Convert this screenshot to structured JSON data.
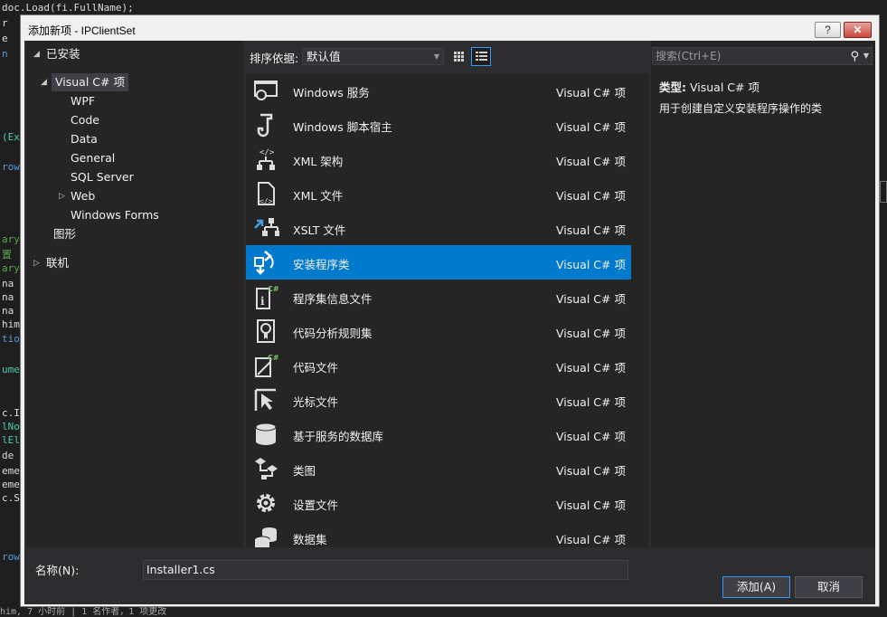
{
  "background_code": {
    "lines": [
      {
        "text": "doc.Load(fi.FullName);",
        "color": "#dcdcdc"
      },
      {
        "text": "r",
        "color": "#dcdcdc"
      },
      {
        "text": "e",
        "color": "#dcdcdc"
      },
      {
        "text": "n",
        "color": "#569cd6"
      },
      {
        "text": "(Ex",
        "color": "#4ec9b0"
      },
      {
        "text": "row",
        "color": "#569cd6"
      },
      {
        "text": "ary",
        "color": "#57a64a"
      },
      {
        "text": "置",
        "color": "#57a64a"
      },
      {
        "text": "ary",
        "color": "#57a64a"
      },
      {
        "text": "na",
        "color": "#dcdcdc"
      },
      {
        "text": "na",
        "color": "#dcdcdc"
      },
      {
        "text": "na",
        "color": "#dcdcdc"
      },
      {
        "text": "him",
        "color": "#dcdcdc"
      },
      {
        "text": "tio",
        "color": "#569cd6"
      },
      {
        "text": "ume",
        "color": "#4ec9b0"
      },
      {
        "text": "c.I",
        "color": "#dcdcdc"
      },
      {
        "text": "lNo",
        "color": "#4ec9b0"
      },
      {
        "text": "lEl",
        "color": "#4ec9b0"
      },
      {
        "text": "de",
        "color": "#dcdcdc"
      },
      {
        "text": "eme",
        "color": "#dcdcdc"
      },
      {
        "text": "eme",
        "color": "#dcdcdc"
      },
      {
        "text": "c.S",
        "color": "#dcdcdc"
      },
      {
        "text": "row",
        "color": "#569cd6"
      }
    ],
    "status_text": "him, 7 小时前 | 1 名作者，1 项更改"
  },
  "dialog": {
    "title": "添加新项 - IPClientSet",
    "help_label": "?",
    "close_label": "✕"
  },
  "tree": {
    "installed": "已安装",
    "visual_csharp": "Visual C# 项",
    "children": [
      "WPF",
      "Code",
      "Data",
      "General",
      "SQL Server",
      "Web",
      "Windows Forms"
    ],
    "graphics": "图形",
    "online": "联机"
  },
  "toolbar": {
    "sort_label": "排序依据:",
    "sort_value": "默认值"
  },
  "search": {
    "placeholder": "搜索(Ctrl+E)"
  },
  "items": [
    {
      "name": "Windows 服务",
      "type": "Visual C# 项",
      "icon": "windows-service-icon"
    },
    {
      "name": "Windows 脚本宿主",
      "type": "Visual C# 项",
      "icon": "script-host-icon"
    },
    {
      "name": "XML 架构",
      "type": "Visual C# 项",
      "icon": "xml-schema-icon"
    },
    {
      "name": "XML 文件",
      "type": "Visual C# 项",
      "icon": "xml-file-icon"
    },
    {
      "name": "XSLT 文件",
      "type": "Visual C# 项",
      "icon": "xslt-file-icon"
    },
    {
      "name": "安装程序类",
      "type": "Visual C# 项",
      "icon": "installer-class-icon",
      "selected": true
    },
    {
      "name": "程序集信息文件",
      "type": "Visual C# 项",
      "icon": "assembly-info-icon"
    },
    {
      "name": "代码分析规则集",
      "type": "Visual C# 项",
      "icon": "ruleset-icon"
    },
    {
      "name": "代码文件",
      "type": "Visual C# 项",
      "icon": "code-file-icon"
    },
    {
      "name": "光标文件",
      "type": "Visual C# 项",
      "icon": "cursor-file-icon"
    },
    {
      "name": "基于服务的数据库",
      "type": "Visual C# 项",
      "icon": "database-icon"
    },
    {
      "name": "类图",
      "type": "Visual C# 项",
      "icon": "class-diagram-icon"
    },
    {
      "name": "设置文件",
      "type": "Visual C# 项",
      "icon": "settings-file-icon"
    },
    {
      "name": "数据集",
      "type": "Visual C# 项",
      "icon": "dataset-icon"
    }
  ],
  "info": {
    "type_label": "类型:",
    "type_value": "Visual C# 项",
    "description": "用于创建自定义安装程序操作的类"
  },
  "bottom": {
    "name_label": "名称(N):",
    "name_value": "Installer1.cs",
    "add_label": "添加(A)",
    "cancel_label": "取消"
  },
  "colors": {
    "selection": "#007acc",
    "panel": "#252526",
    "dialog": "#2d2d30"
  }
}
